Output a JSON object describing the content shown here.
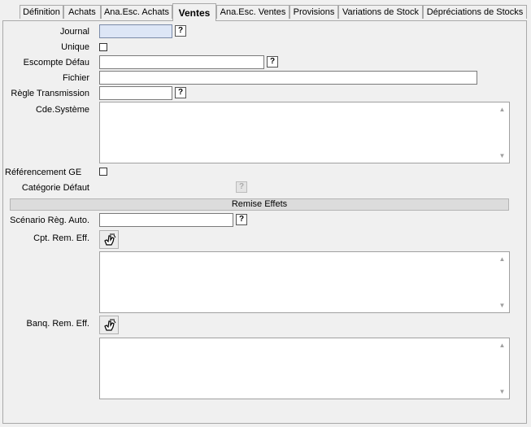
{
  "tabs": [
    {
      "label": "Définition",
      "active": false
    },
    {
      "label": "Achats",
      "active": false
    },
    {
      "label": "Ana.Esc. Achats",
      "active": false
    },
    {
      "label": "Ventes",
      "active": true
    },
    {
      "label": "Ana.Esc. Ventes",
      "active": false
    },
    {
      "label": "Provisions",
      "active": false
    },
    {
      "label": "Variations de Stock",
      "active": false
    },
    {
      "label": "Dépréciations de Stocks",
      "active": false
    }
  ],
  "form": {
    "journal_label": "Journal",
    "journal_value": "",
    "unique_label": "Unique",
    "unique_checked": false,
    "escompte_label": "Escompte Défau",
    "escompte_value": "",
    "fichier_label": "Fichier",
    "fichier_value": "",
    "regle_label": "Règle Transmission",
    "regle_value": "",
    "cde_label": "Cde.Système",
    "cde_value": "",
    "referencement_label": "Référencement GE",
    "referencement_checked": false,
    "categorie_label": "Catégorie Défaut",
    "help_glyph": "?"
  },
  "remise": {
    "section_title": "Remise Effets",
    "scenario_label": "Scénario Règ. Auto.",
    "scenario_value": "",
    "cpt_label": "Cpt. Rem. Eff.",
    "banq_label": "Banq. Rem. Eff."
  },
  "icons": {
    "picker": "hand-pointer-icon",
    "scroll_up": "▲",
    "scroll_down": "▼"
  },
  "colors": {
    "journal_field_bg": "#dde6f6",
    "section_bar_bg": "#dcdcdc"
  }
}
